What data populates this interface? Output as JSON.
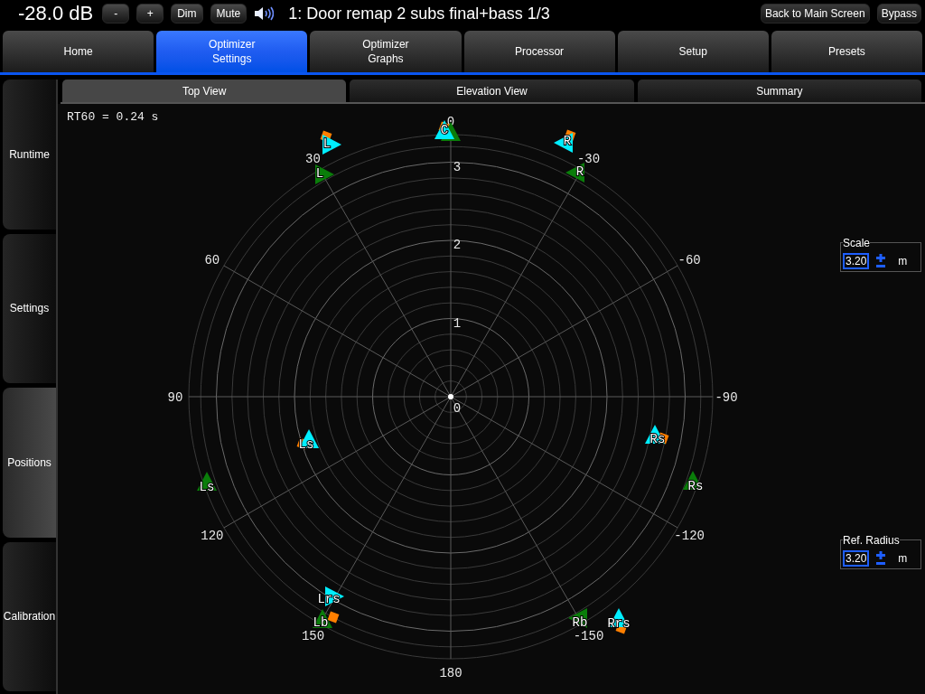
{
  "header": {
    "volume": "-28.0 dB",
    "buttons": [
      "-",
      "+",
      "Dim",
      "Mute"
    ],
    "title": "1: Door remap 2 subs final+bass 1/3",
    "right_buttons": [
      "Back to Main Screen",
      "Bypass"
    ]
  },
  "tabs": [
    {
      "label": "Home",
      "selected": false
    },
    {
      "label": "Optimizer\nSettings",
      "selected": true
    },
    {
      "label": "Optimizer\nGraphs",
      "selected": false
    },
    {
      "label": "Processor",
      "selected": false
    },
    {
      "label": "Setup",
      "selected": false
    },
    {
      "label": "Presets",
      "selected": false
    }
  ],
  "sidebar": [
    {
      "label": "Runtime",
      "selected": false
    },
    {
      "label": "Settings",
      "selected": false
    },
    {
      "label": "Positions",
      "selected": true
    },
    {
      "label": "Calibration",
      "selected": false
    }
  ],
  "subtabs": [
    {
      "label": "Top View",
      "selected": true
    },
    {
      "label": "Elevation View",
      "selected": false
    },
    {
      "label": "Summary",
      "selected": false
    }
  ],
  "plot": {
    "readout": "RT60 = 0.24 s",
    "center_label": "0",
    "ring_labels": [
      "3",
      "2",
      "1"
    ],
    "angle_labels": [
      "0",
      "30",
      "60",
      "90",
      "120",
      "150",
      "180",
      "-150",
      "-120",
      "-90",
      "-60",
      "-30"
    ],
    "markers": [
      {
        "kind": "triangle",
        "color": "#0a7d0a",
        "label": "L"
      },
      {
        "kind": "triangle",
        "color": "#0a7d0a"
      },
      {
        "kind": "triangle",
        "color": "#0a7d0a",
        "label": "R"
      },
      {
        "kind": "triangle",
        "color": "#0a7d0a",
        "label": "Ls"
      },
      {
        "kind": "triangle",
        "color": "#0a7d0a",
        "label": "Rs"
      },
      {
        "kind": "triangle",
        "color": "#0a7d0a",
        "label": "Lb"
      },
      {
        "kind": "triangle",
        "color": "#0a7d0a",
        "label": "Rb"
      },
      {
        "kind": "triangle",
        "color": "#00eeff",
        "label": "L"
      },
      {
        "kind": "triangle",
        "color": "#00eeff",
        "label": "C"
      },
      {
        "kind": "triangle",
        "color": "#00eeff",
        "label": "R"
      },
      {
        "kind": "triangle",
        "color": "#00eeff",
        "label": "Ls"
      },
      {
        "kind": "triangle",
        "color": "#00eeff",
        "label": "Rs"
      },
      {
        "kind": "triangle",
        "color": "#00eeff",
        "label": "Lrs"
      },
      {
        "kind": "triangle",
        "color": "#00eeff",
        "label": "Rrs"
      },
      {
        "kind": "square",
        "color": "#ff7f00"
      },
      {
        "kind": "square",
        "color": "#ff7f00"
      },
      {
        "kind": "square",
        "color": "#ff7f00"
      },
      {
        "kind": "square",
        "color": "#ff7f00"
      },
      {
        "kind": "square",
        "color": "#ff7f00"
      },
      {
        "kind": "square",
        "color": "#ff7f00"
      },
      {
        "kind": "square",
        "color": "#ff7f00"
      }
    ]
  },
  "controls": [
    {
      "label": "Scale",
      "value": "3.20",
      "unit": "m"
    },
    {
      "label": "Ref. Radius",
      "value": "3.20",
      "unit": "m"
    }
  ]
}
